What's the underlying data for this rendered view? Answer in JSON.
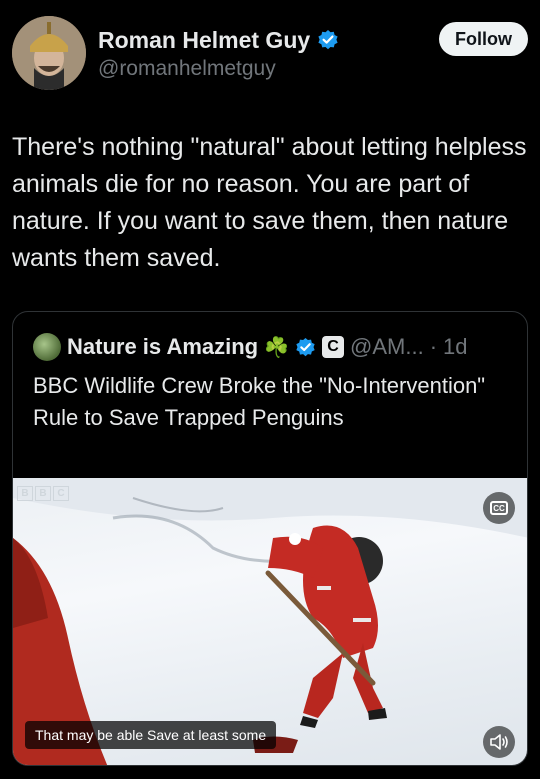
{
  "author": {
    "name": "Roman Helmet Guy",
    "handle": "@romanhelmetguy",
    "avatar_icon": "profile-avatar-icon",
    "verified_icon": "verified-badge-icon"
  },
  "follow_button": {
    "label": "Follow"
  },
  "tweet": {
    "text": "There's nothing \"natural\" about letting helpless animals die for no reason. You are part of nature. If you want to save them, then nature wants them saved."
  },
  "quoted_tweet": {
    "name": "Nature is Amazing",
    "emoji": "☘️",
    "verified_icon": "verified-badge-icon",
    "affiliate_badge": "C",
    "handle": "@AM...",
    "dot": "·",
    "time": "1d",
    "text": "BBC Wildlife Crew Broke the \"No-Intervention\" Rule to Save Trapped Penguins",
    "media": {
      "watermark_letters": [
        "B",
        "B",
        "C"
      ],
      "cc_label": "CC",
      "caption": "That may be able Save at least some",
      "mute_icon": "speaker-icon"
    }
  },
  "colors": {
    "background": "#000000",
    "text": "#e7e9ea",
    "muted": "#71767b",
    "verified": "#1d9bf0",
    "button": "#eff3f4"
  }
}
